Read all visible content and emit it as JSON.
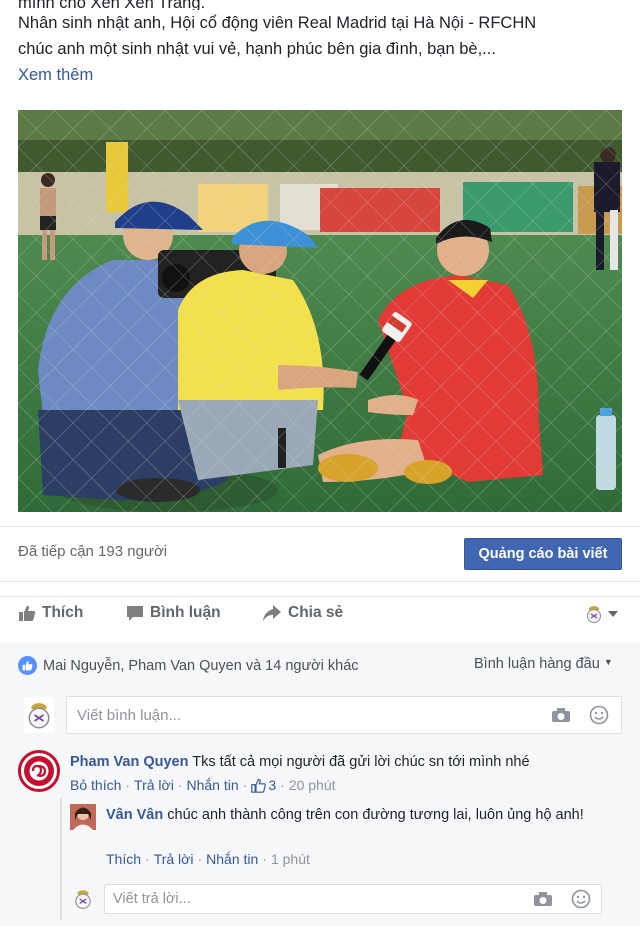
{
  "post": {
    "line0": "mình cho Xen Xen Trang.",
    "line1": "Nhân sinh nhật anh, Hội cổ động viên Real Madrid tại Hà Nội - RFCHN",
    "line2": "chúc anh một sinh nhật vui vẻ, hạnh phúc bên gia đình, bạn bè,...",
    "see_more": "Xem thêm"
  },
  "reach": {
    "text": "Đã tiếp cận 193 người",
    "boost_label": "Quảng cáo bài viết"
  },
  "actions": {
    "like": "Thích",
    "comment": "Bình luận",
    "share": "Chia sẻ"
  },
  "reactions": {
    "summary": "Mai Nguyễn, Pham Van Quyen và 14 người khác",
    "sort": "Bình luận hàng đầu"
  },
  "composer": {
    "placeholder": "Viết bình luận..."
  },
  "comment": {
    "author": "Pham Van Quyen",
    "text": "Tks tất cả mọi người đã gửi lời chúc sn tới mình nhé",
    "unlike": "Bỏ thích",
    "reply": "Trả lời",
    "message": "Nhắn tin",
    "like_count": "3",
    "time": "20 phút"
  },
  "reply": {
    "author": "Vân Vân",
    "text": "chúc anh thành công trên con đường tương lai, luôn ủng hộ anh!",
    "like": "Thích",
    "reply": "Trả lời",
    "message": "Nhắn tin",
    "time": "1 phút"
  },
  "reply_composer": {
    "placeholder": "Viết trả lời..."
  },
  "colors": {
    "accent": "#4267b2",
    "link": "#365899",
    "avatar_red": "#c8102e"
  }
}
